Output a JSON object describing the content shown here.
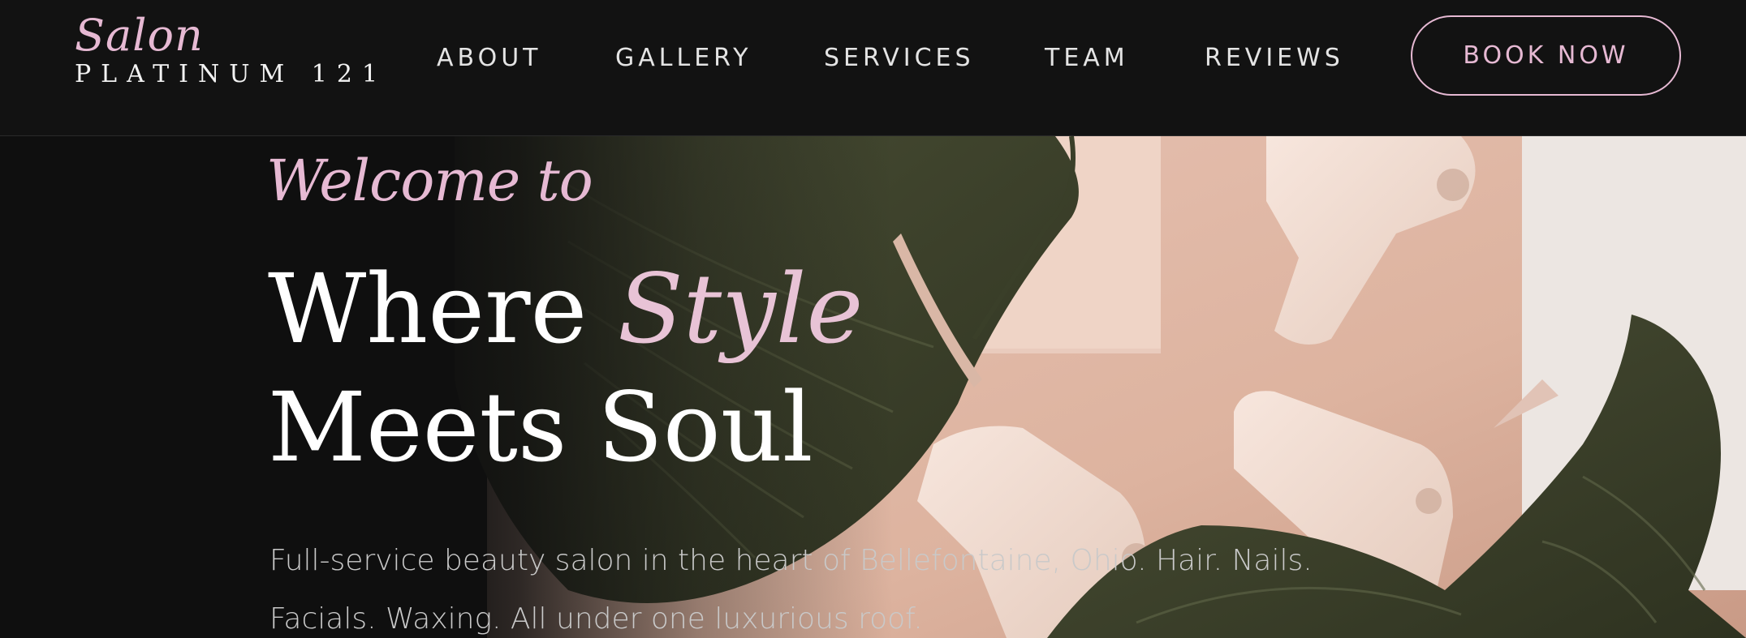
{
  "brand": {
    "script": "Salon",
    "name": "PLATINUM 121"
  },
  "nav": {
    "items": [
      {
        "label": "ABOUT"
      },
      {
        "label": "GALLERY"
      },
      {
        "label": "SERVICES"
      },
      {
        "label": "TEAM"
      },
      {
        "label": "REVIEWS"
      }
    ],
    "cta": "BOOK NOW"
  },
  "hero": {
    "welcome": "Welcome to",
    "headline_part1": "Where ",
    "headline_accent": "Style",
    "headline_line2": "Meets Soul",
    "description_line1": "Full-service beauty salon in the heart of Bellefontaine, Ohio. Hair. Nails.",
    "description_line2": "Facials. Waxing. All under one luxurious roof."
  },
  "colors": {
    "background": "#0f0f0f",
    "nav_background": "#121212",
    "accent_pink": "#e6b9d3",
    "text_light": "#e4e4e4"
  }
}
